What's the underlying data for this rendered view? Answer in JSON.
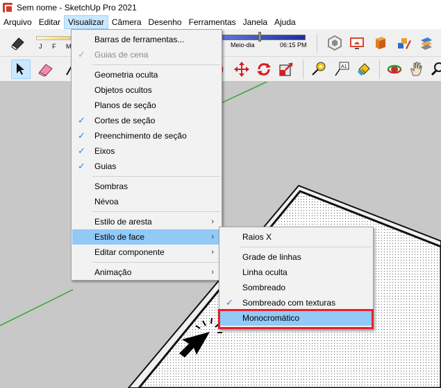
{
  "window": {
    "title": "Sem nome - SketchUp Pro 2021"
  },
  "menubar": [
    {
      "label": "Arquivo"
    },
    {
      "label": "Editar"
    },
    {
      "label": "Visualizar",
      "active": true
    },
    {
      "label": "Câmera"
    },
    {
      "label": "Desenho"
    },
    {
      "label": "Ferramentas"
    },
    {
      "label": "Janela"
    },
    {
      "label": "Ajuda"
    }
  ],
  "shadows": {
    "months_label": "J F M",
    "noon_label": "Meio-dia",
    "time_label": "06:15 PM"
  },
  "visualizar_menu": {
    "items": [
      {
        "label": "Barras de ferramentas..."
      },
      {
        "label": "Guias de cena",
        "checked": true,
        "disabled": true
      },
      {
        "label": "Geometria oculta"
      },
      {
        "label": "Objetos ocultos"
      },
      {
        "label": "Planos de seção"
      },
      {
        "label": "Cortes de seção",
        "checked": true
      },
      {
        "label": "Preenchimento de seção",
        "checked": true
      },
      {
        "label": "Eixos",
        "checked": true
      },
      {
        "label": "Guias",
        "checked": true
      },
      {
        "label": "Sombras"
      },
      {
        "label": "Névoa"
      },
      {
        "label": "Estilo de aresta",
        "submenu": true
      },
      {
        "label": "Estilo de face",
        "submenu": true,
        "highlighted": true
      },
      {
        "label": "Editar componente",
        "submenu": true
      },
      {
        "label": "Animação",
        "submenu": true
      }
    ]
  },
  "face_style_menu": {
    "items": [
      {
        "label": "Raios X"
      },
      {
        "label": "Grade de linhas"
      },
      {
        "label": "Linha oculta"
      },
      {
        "label": "Sombreado"
      },
      {
        "label": "Sombreado com texturas",
        "checked": true
      },
      {
        "label": "Monocromático",
        "highlighted": true
      }
    ]
  },
  "glyphs": {
    "check": "✓",
    "submenu_arrow": "›"
  },
  "colors": {
    "menu_hover": "#91c9f7",
    "check": "#2f7fd0",
    "annotation_box": "#e8202a",
    "axis_green": "#2aa82a"
  }
}
